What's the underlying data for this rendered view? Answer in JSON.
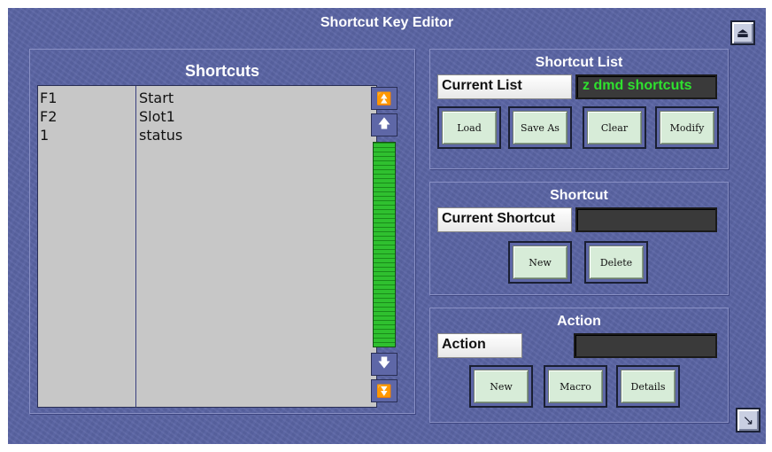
{
  "window": {
    "title": "Shortcut Key Editor"
  },
  "shortcuts": {
    "title": "Shortcuts",
    "rows": [
      {
        "key": "F1",
        "action": "Start"
      },
      {
        "key": "F2",
        "action": "Slot1"
      },
      {
        "key": "1",
        "action": "status"
      }
    ],
    "scrollbar": {
      "top_icon": "double-up-arrow-icon",
      "up_icon": "up-arrow-icon",
      "down_icon": "down-arrow-icon",
      "bottom_icon": "double-down-arrow-icon"
    }
  },
  "shortcut_list": {
    "title": "Shortcut List",
    "current_label": "Current List",
    "current_value": "z dmd shortcuts",
    "value_color": "#2fe02f",
    "buttons": [
      "Load",
      "Save As",
      "Clear",
      "Modify"
    ]
  },
  "shortcut": {
    "title": "Shortcut",
    "current_label": "Current Shortcut",
    "current_value": "",
    "buttons": [
      "New",
      "Delete"
    ]
  },
  "action": {
    "title": "Action",
    "label": "Action",
    "value": "",
    "buttons": [
      "New",
      "Macro",
      "Details"
    ]
  },
  "corner_buttons": {
    "top_icon": "eject-up-icon",
    "bottom_icon": "arrow-down-right-icon"
  }
}
